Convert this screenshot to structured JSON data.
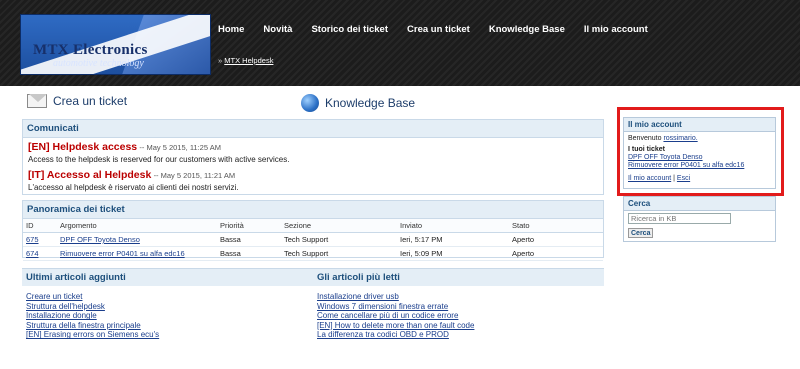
{
  "brand": {
    "line1": "MTX Electronics",
    "line2": "automotive technology"
  },
  "nav": [
    "Home",
    "Novità",
    "Storico dei ticket",
    "Crea un ticket",
    "Knowledge Base",
    "Il mio account"
  ],
  "breadcrumb": {
    "sep": "»",
    "link": "MTX Helpdesk"
  },
  "quick": {
    "create": "Crea un ticket",
    "kb": "Knowledge Base"
  },
  "news": {
    "title": "Comunicati",
    "items": [
      {
        "title": "[EN] Helpdesk access",
        "date": "-- May 5 2015, 11:25 AM",
        "body": "Access to the helpdesk is reserved for our customers with active services."
      },
      {
        "title": "[IT] Accesso al Helpdesk",
        "date": "-- May 5 2015, 11:21 AM",
        "body": "L'accesso al helpdesk è riservato ai clienti dei nostri servizi."
      }
    ]
  },
  "tickets": {
    "title": "Panoramica dei ticket",
    "headers": [
      "ID",
      "Argomento",
      "Priorità",
      "Sezione",
      "Inviato",
      "Stato"
    ],
    "rows": [
      {
        "id": "675",
        "subject": "DPF OFF Toyota Denso",
        "priority": "Bassa",
        "section": "Tech Support",
        "sent": "Ieri, 5:17 PM",
        "status": "Aperto"
      },
      {
        "id": "674",
        "subject": "Rimuovere error P0401 su alfa edc16",
        "priority": "Bassa",
        "section": "Tech Support",
        "sent": "Ieri, 5:09 PM",
        "status": "Aperto"
      }
    ]
  },
  "latest": {
    "title": "Ultimi articoli aggiunti",
    "items": [
      "Creare un ticket",
      "Struttura dell'helpdesk",
      "Installazione dongle",
      "Struttura della finestra principale",
      "[EN] Erasing errors on Siemens ecu's"
    ]
  },
  "popular": {
    "title": "Gli articoli più letti",
    "items": [
      "Installazione driver usb",
      "Windows 7 dimensioni finestra errate",
      "Come cancellare più di un codice errore",
      "[EN] How to delete more than one fault code",
      "La differenza tra codici OBD e PROD"
    ]
  },
  "account": {
    "title": "Il mio account",
    "welcome": "Benvenuto",
    "user": "rossimario.",
    "tickets_label": "I tuoi ticket",
    "tickets": [
      "DPF OFF Toyota Denso",
      "Rimuovere error P0401 su alfa edc16"
    ],
    "my_account": "Il mio account",
    "sep": "|",
    "logout": "Esci"
  },
  "search": {
    "title": "Cerca",
    "placeholder": "Ricerca in KB",
    "button": "Cerca"
  }
}
